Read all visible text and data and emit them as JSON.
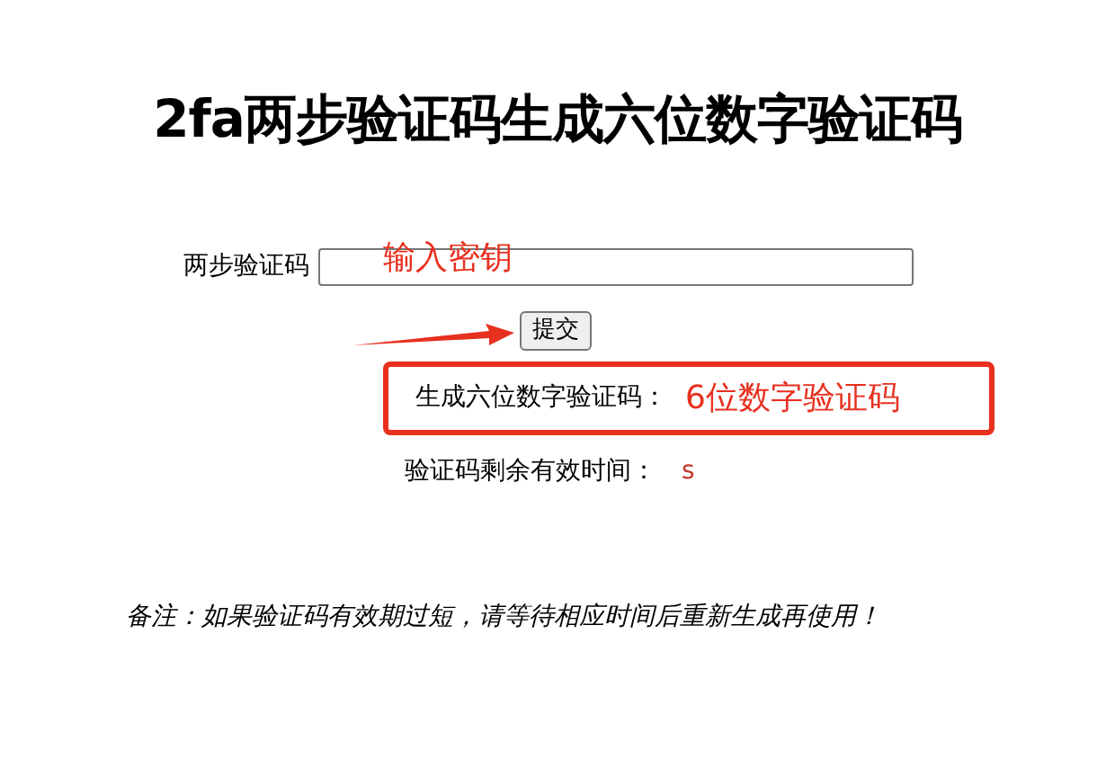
{
  "title": "2fa两步验证码生成六位数字验证码",
  "secret_field": {
    "label": "两步验证码",
    "annotation": "输入密钥"
  },
  "submit_button": "提交",
  "result": {
    "label": "生成六位数字验证码：",
    "annotation": "6位数字验证码"
  },
  "timer": {
    "label": "验证码剩余有效时间：",
    "unit": "s"
  },
  "note": "备注：如果验证码有效期过短，请等待相应时间后重新生成再使用！"
}
